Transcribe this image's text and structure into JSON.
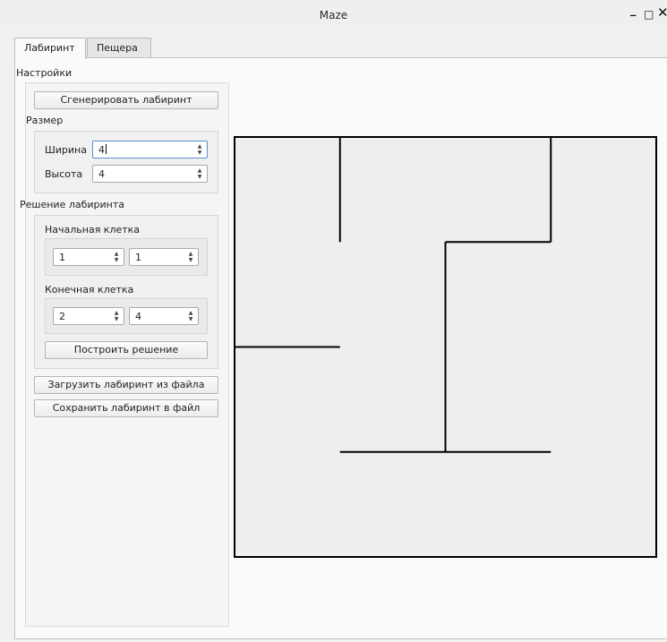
{
  "window": {
    "title": "Maze",
    "controls": {
      "minimize": "_",
      "maximize": "□",
      "close": "✕"
    }
  },
  "tabs": [
    {
      "label": "Лабиринт",
      "active": true
    },
    {
      "label": "Пещера",
      "active": false
    }
  ],
  "settings": {
    "title": "Настройки",
    "generate_button": "Сгенерировать лабиринт",
    "size": {
      "title": "Размер",
      "width_label": "Ширина",
      "width_value": "4",
      "height_label": "Высота",
      "height_value": "4"
    },
    "solution": {
      "title": "Решение лабиринта",
      "start_label": "Начальная клетка",
      "start_values": [
        "1",
        "1"
      ],
      "end_label": "Конечная клетка",
      "end_values": [
        "2",
        "4"
      ],
      "build_button": "Построить решение"
    },
    "load_button": "Загрузить лабиринт из файла",
    "save_button": "Сохранить лабиринт в файл"
  },
  "maze": {
    "rows": 4,
    "cols": 4,
    "right_walls": [
      [
        1,
        0,
        1,
        1
      ],
      [
        0,
        1,
        0,
        1
      ],
      [
        0,
        1,
        0,
        1
      ],
      [
        0,
        0,
        0,
        1
      ]
    ],
    "bottom_walls": [
      [
        0,
        0,
        1,
        0
      ],
      [
        1,
        0,
        0,
        0
      ],
      [
        0,
        1,
        1,
        0
      ],
      [
        1,
        1,
        1,
        1
      ]
    ],
    "line_color": "#000000",
    "background": "#eeeeee"
  }
}
